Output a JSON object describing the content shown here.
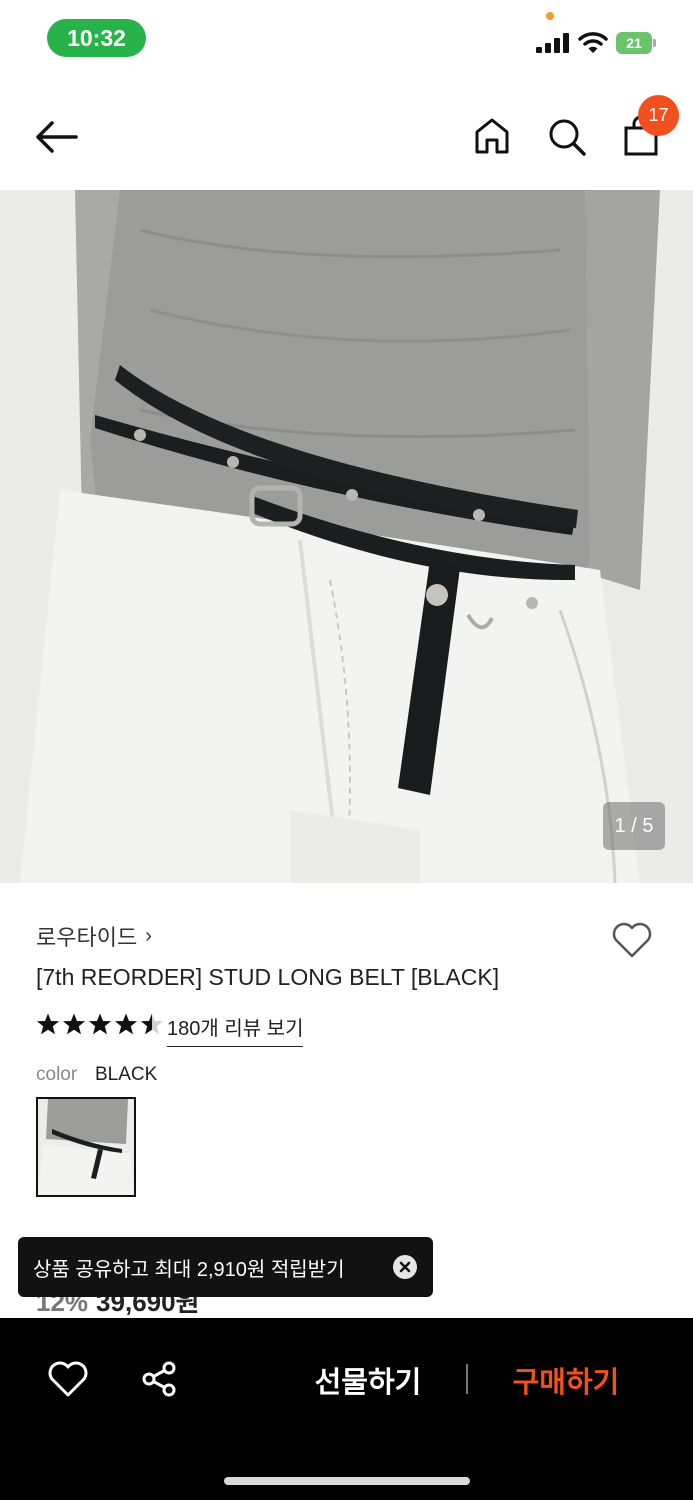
{
  "status_bar": {
    "time": "10:32",
    "battery": "21"
  },
  "header": {
    "cart_count": "17"
  },
  "gallery": {
    "indicator": "1 / 5"
  },
  "product": {
    "brand": "로우타이드",
    "title": "[7th REORDER] STUD LONG BELT [BLACK]",
    "rating": 4.5,
    "review_link": "180개 리뷰 보기",
    "color_label": "color",
    "color_value": "BLACK",
    "discount": "12%",
    "price": "39,690원"
  },
  "toast": {
    "message": "상품 공유하고 최대 2,910원 적립받기"
  },
  "bottom_bar": {
    "gift": "선물하기",
    "buy": "구매하기"
  },
  "colors": {
    "accent": "#f2501e",
    "status_green": "#27b24a"
  }
}
